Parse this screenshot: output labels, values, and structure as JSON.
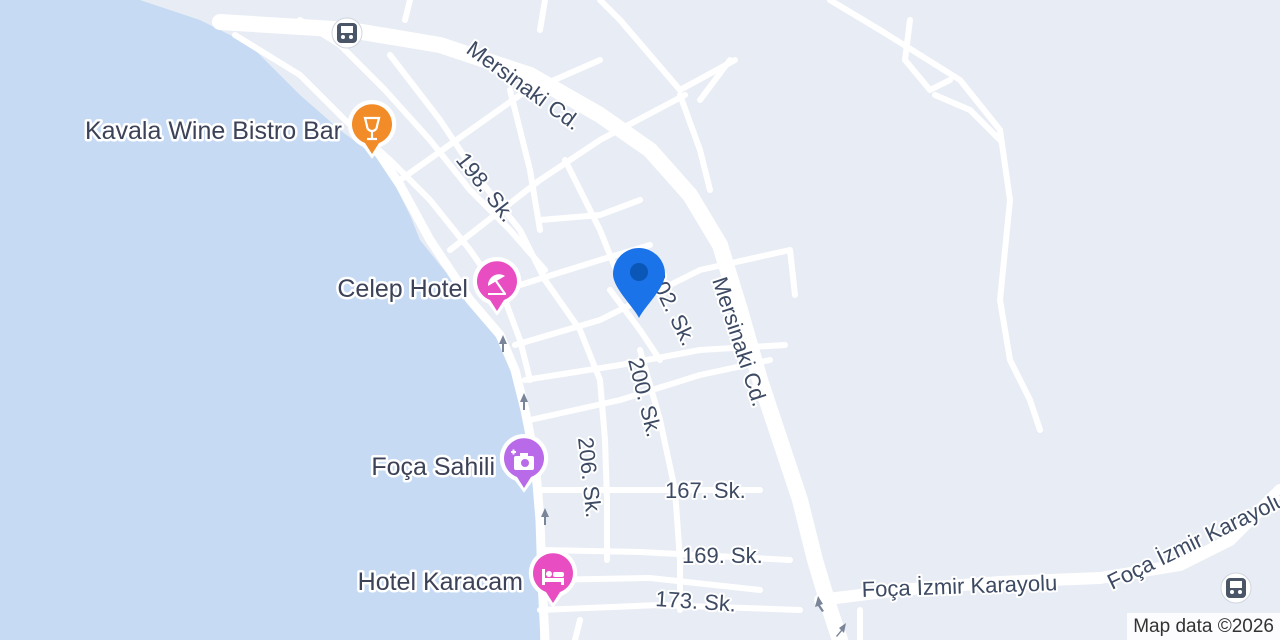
{
  "colors": {
    "land": "#e8ecf4",
    "water": "#c6dbf3",
    "road": "#ffffff",
    "road_label": "#3d4a63",
    "poi_label": "#3c4257",
    "food_poi": "#f28c28",
    "lodging_poi": "#e84ec2",
    "attraction_poi": "#b96ae8",
    "transit_poi": "#4a5568",
    "location_pin": "#1a73e8"
  },
  "roads": {
    "mersinaki_upper": "Mersinaki Cd.",
    "mersinaki_lower": "Mersinaki Cd.",
    "r198": "198. Sk.",
    "r202": "202. Sk.",
    "r200": "200. Sk.",
    "r206": "206. Sk.",
    "r167": "167. Sk.",
    "r169": "169. Sk.",
    "r173": "173. Sk.",
    "karayolu_1": "Foça İzmir Karayolu",
    "karayolu_2": "Foça İzmir Karayolu"
  },
  "pois": [
    {
      "name": "Kavala Wine Bistro Bar",
      "icon": "wine-glass-icon",
      "color": "#f28c28"
    },
    {
      "name": "Celep Hotel",
      "icon": "beach-umbrella-icon",
      "color": "#e84ec2"
    },
    {
      "name": "Foça Sahili",
      "icon": "camera-icon",
      "color": "#b96ae8"
    },
    {
      "name": "Hotel Karacam",
      "icon": "bed-icon",
      "color": "#e84ec2"
    }
  ],
  "transit": [
    {
      "icon": "bus-stop-icon"
    },
    {
      "icon": "bus-stop-icon"
    }
  ],
  "location_pin": {
    "icon": "location-pin-icon"
  },
  "attribution": "Map data ©2026"
}
